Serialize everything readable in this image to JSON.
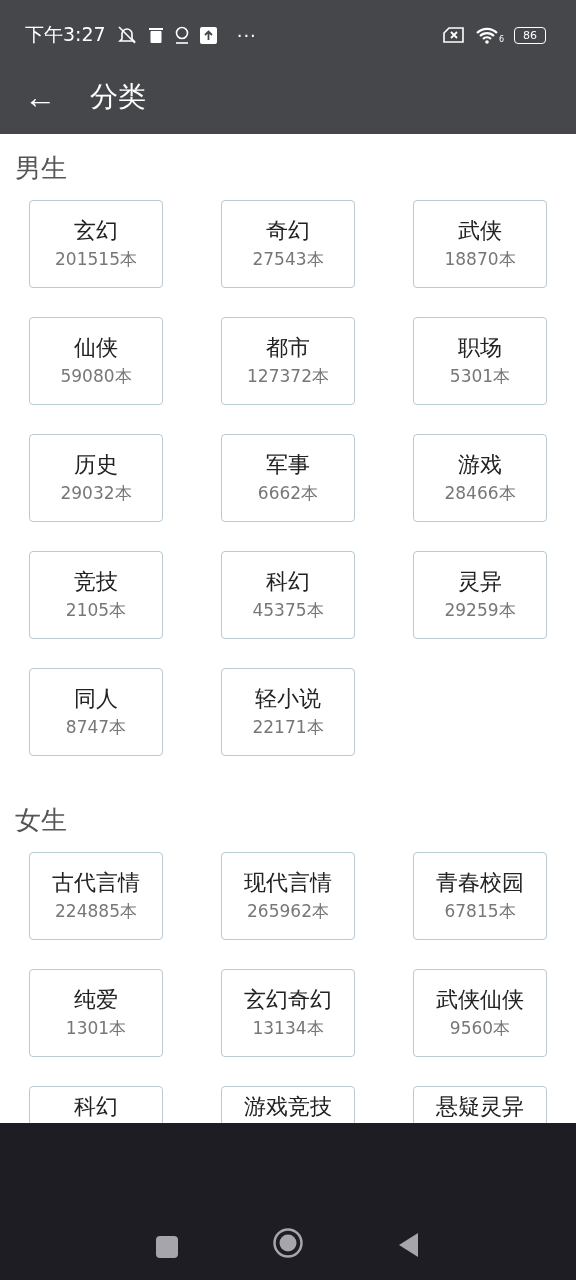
{
  "status_bar": {
    "time": "下午3:27",
    "more": "···",
    "wifi_label": "6",
    "battery": "86"
  },
  "app_bar": {
    "back": "←",
    "title": "分类"
  },
  "sections": [
    {
      "title": "男生",
      "items": [
        {
          "name": "玄幻",
          "count": "201515本"
        },
        {
          "name": "奇幻",
          "count": "27543本"
        },
        {
          "name": "武侠",
          "count": "18870本"
        },
        {
          "name": "仙侠",
          "count": "59080本"
        },
        {
          "name": "都市",
          "count": "127372本"
        },
        {
          "name": "职场",
          "count": "5301本"
        },
        {
          "name": "历史",
          "count": "29032本"
        },
        {
          "name": "军事",
          "count": "6662本"
        },
        {
          "name": "游戏",
          "count": "28466本"
        },
        {
          "name": "竞技",
          "count": "2105本"
        },
        {
          "name": "科幻",
          "count": "45375本"
        },
        {
          "name": "灵异",
          "count": "29259本"
        },
        {
          "name": "同人",
          "count": "8747本"
        },
        {
          "name": "轻小说",
          "count": "22171本"
        }
      ]
    },
    {
      "title": "女生",
      "items": [
        {
          "name": "古代言情",
          "count": "224885本"
        },
        {
          "name": "现代言情",
          "count": "265962本"
        },
        {
          "name": "青春校园",
          "count": "67815本"
        },
        {
          "name": "纯爱",
          "count": "1301本"
        },
        {
          "name": "玄幻奇幻",
          "count": "13134本"
        },
        {
          "name": "武侠仙侠",
          "count": "9560本"
        },
        {
          "name": "科幻"
        },
        {
          "name": "游戏竞技"
        },
        {
          "name": "悬疑灵异"
        }
      ]
    }
  ]
}
